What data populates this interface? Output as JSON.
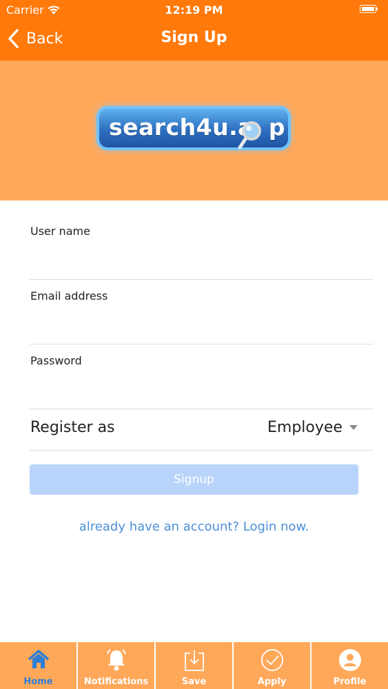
{
  "status_bar": {
    "carrier": "Carrier",
    "time": "12:19 PM"
  },
  "nav": {
    "back_label": "Back",
    "title": "Sign Up"
  },
  "logo": {
    "text": "search4u.a p"
  },
  "form": {
    "username": {
      "label": "User name",
      "value": ""
    },
    "email": {
      "label": "Email address",
      "value": ""
    },
    "password": {
      "label": "Password",
      "value": ""
    },
    "register_as": {
      "label": "Register as",
      "value": "Employee"
    },
    "signup_label": "Signup",
    "login_link": "already have an account? Login now."
  },
  "tabs": [
    {
      "label": "Home",
      "icon": "home-icon",
      "active": true
    },
    {
      "label": "Notifications",
      "icon": "bell-icon",
      "active": false
    },
    {
      "label": "Save",
      "icon": "save-icon",
      "active": false
    },
    {
      "label": "Apply",
      "icon": "check-circle-icon",
      "active": false
    },
    {
      "label": "Profile",
      "icon": "profile-icon",
      "active": false
    }
  ],
  "colors": {
    "nav_bar": "#ff7a0a",
    "banner": "#ffa85a",
    "signup_button": "#b8d4fb",
    "link": "#4a8fd8",
    "active_tab": "#2f7fd6"
  }
}
